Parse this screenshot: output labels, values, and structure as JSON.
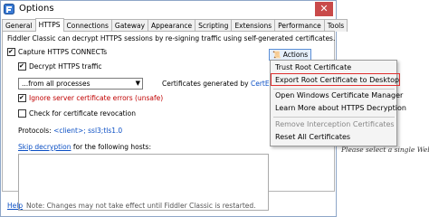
{
  "window": {
    "title": "Options",
    "close_symbol": "✕"
  },
  "tabs": [
    "General",
    "HTTPS",
    "Connections",
    "Gateway",
    "Appearance",
    "Scripting",
    "Extensions",
    "Performance",
    "Tools"
  ],
  "https": {
    "intro": "Fiddler Classic can decrypt HTTPS sessions by re-signing traffic using self-generated certificates.",
    "capture_connects": "Capture HTTPS CONNECTs",
    "decrypt_traffic": "Decrypt HTTPS traffic",
    "process_filter": "...from all processes",
    "ignore_errors": "Ignore server certificate errors (unsafe)",
    "check_revocation": "Check for certificate revocation",
    "protocols_label": "Protocols:",
    "protocols_value": "<client>; ssl3;tls1.0",
    "skip_decryption_link": "Skip decryption",
    "skip_decryption_suffix": "for the following hosts:",
    "generated_by_label": "Certificates generated by",
    "generated_by_engine": "CertEnroll",
    "actions_button": "Actions"
  },
  "actions_menu": {
    "items": [
      "Trust Root Certificate",
      "Export Root Certificate to Desktop",
      "Open Windows Certificate Manager",
      "Learn More about HTTPS Decryption",
      "Remove Interception Certificates",
      "Reset All Certificates"
    ],
    "highlight_color": "#e03030"
  },
  "footer": {
    "help_link": "Help",
    "note": "Note: Changes may not take effect until Fiddler Classic is restarted."
  },
  "background_text": "Please select a single Web"
}
